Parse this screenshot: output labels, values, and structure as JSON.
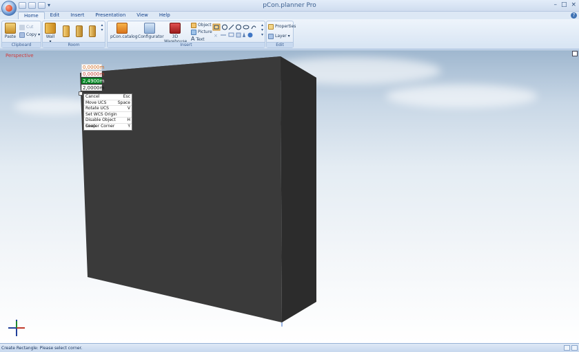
{
  "window": {
    "title": "pCon.planner Pro",
    "controls": [
      "–",
      "□",
      "×"
    ]
  },
  "tabs": [
    {
      "label": "Home",
      "active": true
    },
    {
      "label": "Edit"
    },
    {
      "label": "Insert"
    },
    {
      "label": "Presentation"
    },
    {
      "label": "View"
    },
    {
      "label": "Help"
    }
  ],
  "help_icon": "?",
  "ribbon": {
    "clipboard": {
      "label": "Clipboard",
      "paste": "Paste",
      "cut": "Cut",
      "copy": "Copy"
    },
    "room": {
      "label": "Room",
      "wall": "Wall"
    },
    "insert": {
      "label": "Insert",
      "catalog": "pCon.catalog",
      "configurator": "Configurator",
      "warehouse_line1": "3D",
      "warehouse_line2": "Warehouse",
      "object": "Object",
      "picture": "Picture",
      "text": "Text"
    },
    "edit": {
      "label": "Edit",
      "properties": "Properties",
      "layer": "Layer"
    }
  },
  "viewport": {
    "label": "Perspective",
    "box_color_front": "#3a3a3a",
    "box_color_side": "#2c2c2c",
    "box_color_top": "#4a4a4a"
  },
  "dimension_inputs": [
    {
      "value": "0,0000m",
      "state": "orange"
    },
    {
      "value": "0,0000m",
      "state": "red"
    },
    {
      "value": "2,4900m",
      "state": "active"
    },
    {
      "value": "2,0000m",
      "state": "plain"
    }
  ],
  "context_menu": [
    {
      "label": "Cancel",
      "shortcut": "Esc"
    },
    {
      "label": "Move UCS",
      "shortcut": "Space"
    },
    {
      "label": "Rotate UCS",
      "shortcut": "V"
    },
    {
      "label": "Set WCS Origin",
      "shortcut": ""
    },
    {
      "label": "Disable Object Snap",
      "shortcut": "H"
    },
    {
      "label": "Center Corner",
      "shortcut": "Y"
    }
  ],
  "statusbar": {
    "text": "Create Rectangle: Please select corner."
  }
}
